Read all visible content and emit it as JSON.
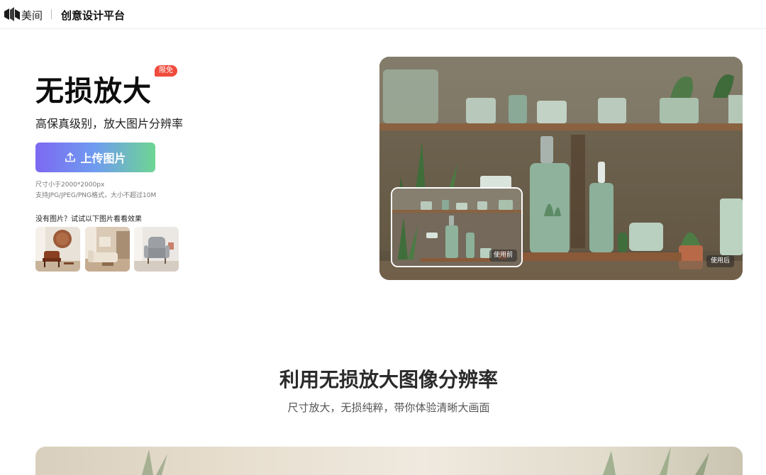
{
  "header": {
    "logo_icon": "meitu-logo-icon",
    "brand": "美间",
    "platform": "创意设计平台"
  },
  "hero": {
    "title": "无损放大",
    "badge": "限免",
    "subtitle": "高保真级别，放大图片分辨率",
    "upload_button": "上传图片",
    "upload_icon": "upload-icon",
    "hint_size": "尺寸小于2000*2000px",
    "hint_format": "支持JPG/JPEG/PNG格式，大小不超过10M",
    "samples_label": "没有图片？试试以下图片看看效果",
    "samples": [
      "living-room-chair-sample",
      "living-room-sofa-sample",
      "gray-armchair-sample"
    ]
  },
  "demo": {
    "before_label": "使用前",
    "after_label": "使用后"
  },
  "section": {
    "title": "利用无损放大图像分辨率",
    "subtitle": "尺寸放大，无损纯粹，带你体验清晰大画面"
  },
  "colors": {
    "badge": "#f04b3c",
    "button_gradient": [
      "#7d69f2",
      "#6f9cf0",
      "#6ed593"
    ]
  }
}
